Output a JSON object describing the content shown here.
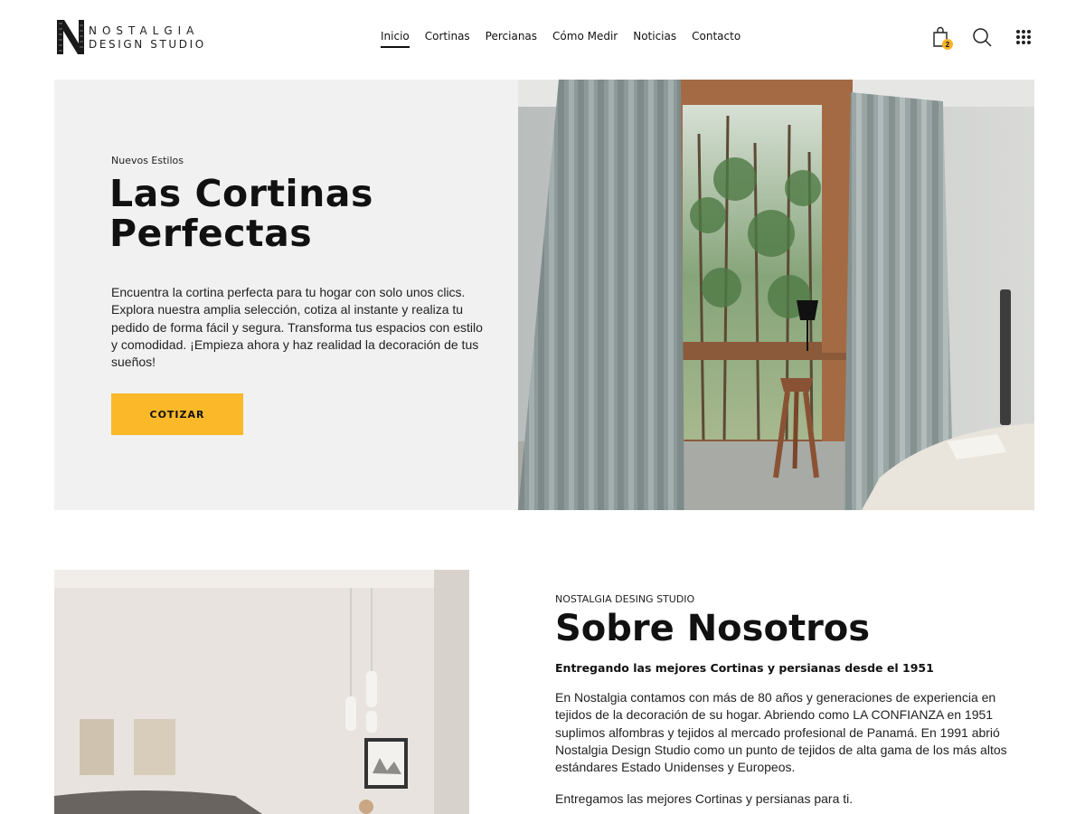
{
  "brand": {
    "line1": "NOSTALGIA",
    "line2": "DESIGN STUDIO"
  },
  "nav": {
    "items": [
      {
        "label": "Inicio",
        "active": true
      },
      {
        "label": "Cortinas",
        "active": false
      },
      {
        "label": "Percianas",
        "active": false
      },
      {
        "label": "Cómo Medir",
        "active": false
      },
      {
        "label": "Noticias",
        "active": false
      },
      {
        "label": "Contacto",
        "active": false
      }
    ]
  },
  "header_icons": {
    "cart_icon": "shopping-bag-icon",
    "cart_count": "2",
    "search_icon": "search-icon",
    "menu_icon": "grid-menu-icon"
  },
  "hero": {
    "eyebrow": "Nuevos Estilos",
    "title": "Las Cortinas Perfectas",
    "description": "Encuentra la cortina perfecta para tu hogar con solo unos clics. Explora nuestra amplia selección, cotiza al instante y realiza tu pedido de forma fácil y segura. Transforma tus espacios con estilo y comodidad. ¡Empieza ahora y haz realidad la decoración de tus sueños!",
    "cta_label": "COTIZAR"
  },
  "about": {
    "eyebrow": "NOSTALGIA DESING STUDIO",
    "title": "Sobre Nosotros",
    "subtitle": "Entregando las mejores Cortinas y persianas desde el 1951",
    "paragraph1": "En Nostalgia contamos con más de 80 años y generaciones de experiencia en tejidos de la decoración de su hogar. Abriendo como LA CONFIANZA en 1951 suplimos alfombras y tejidos al mercado profesional de Panamá. En 1991 abrió Nostalgia Design Studio como un punto de tejidos de alta gama de los más altos estándares Estado Unidenses y Europeos.",
    "paragraph2": "Entregamos las mejores Cortinas y persianas para ti."
  },
  "colors": {
    "accent": "#fbb829",
    "hero_bg": "#f1f1f1",
    "text": "#111111"
  }
}
